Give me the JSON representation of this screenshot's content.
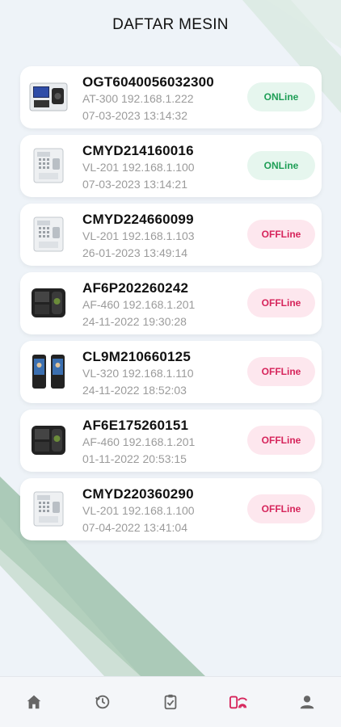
{
  "header": {
    "title": "DAFTAR MESIN"
  },
  "colors": {
    "online": "#1e9e56",
    "offline": "#d6245b",
    "nav_active": "#d6245b",
    "nav_inactive": "#666666"
  },
  "machines": [
    {
      "serial": "OGT6040056032300",
      "model_ip": "AT-300 192.168.1.222",
      "timestamp": "07-03-2023 13:14:32",
      "status": "ONLine",
      "device_icon": "terminal-screen-device-icon"
    },
    {
      "serial": "CMYD214160016",
      "model_ip": "VL-201 192.168.1.100",
      "timestamp": "07-03-2023 13:14:21",
      "status": "ONLine",
      "device_icon": "keypad-device-icon"
    },
    {
      "serial": "CMYD224660099",
      "model_ip": "VL-201 192.168.1.103",
      "timestamp": "26-01-2023 13:49:14",
      "status": "OFFLine",
      "device_icon": "keypad-device-icon"
    },
    {
      "serial": "AF6P202260242",
      "model_ip": "AF-460 192.168.1.201",
      "timestamp": "24-11-2022 19:30:28",
      "status": "OFFLine",
      "device_icon": "fingerprint-device-icon"
    },
    {
      "serial": "CL9M210660125",
      "model_ip": "VL-320 192.168.1.110",
      "timestamp": "24-11-2022 18:52:03",
      "status": "OFFLine",
      "device_icon": "face-device-icon"
    },
    {
      "serial": "AF6E175260151",
      "model_ip": "AF-460 192.168.1.201",
      "timestamp": "01-11-2022 20:53:15",
      "status": "OFFLine",
      "device_icon": "fingerprint-device-icon"
    },
    {
      "serial": "CMYD220360290",
      "model_ip": "VL-201 192.168.1.100",
      "timestamp": "07-04-2022 13:41:04",
      "status": "OFFLine",
      "device_icon": "keypad-device-icon"
    }
  ],
  "bottom_nav": [
    {
      "name": "home-icon",
      "active": false
    },
    {
      "name": "history-icon",
      "active": false
    },
    {
      "name": "checklist-icon",
      "active": false
    },
    {
      "name": "fingerprint-machine-icon",
      "active": true
    },
    {
      "name": "profile-icon",
      "active": false
    }
  ]
}
